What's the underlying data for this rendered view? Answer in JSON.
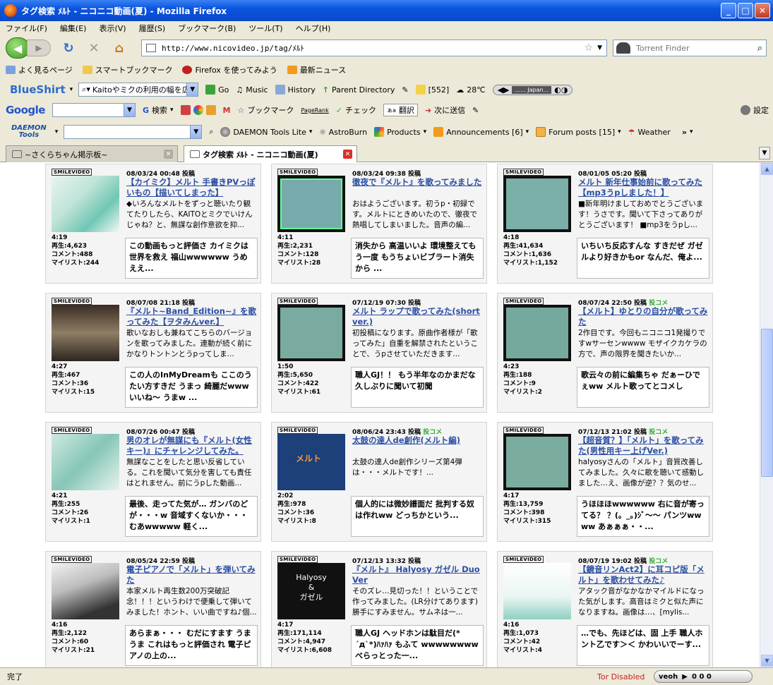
{
  "window": {
    "title": "タグ検索 ﾒﾙﾄ - ニコニコ動画(夏) - Mozilla Firefox"
  },
  "menu": [
    "ファイル(F)",
    "編集(E)",
    "表示(V)",
    "履歴(S)",
    "ブックマーク(B)",
    "ツール(T)",
    "ヘルプ(H)"
  ],
  "nav": {
    "url": "http://www.nicovideo.jp/tag/ﾒﾙﾄ",
    "search_placeholder": "Torrent Finder"
  },
  "bookmarks": [
    "よく見るページ",
    "スマートブックマーク",
    "Firefox を使ってみよう",
    "最新ニュース"
  ],
  "toolbar1": {
    "brand": "BlueShirt",
    "search_value": "Kaitoやミクの利用の幅を広",
    "items": [
      "Go",
      "Music",
      "History",
      "Parent Directory",
      "[552]",
      "28℃"
    ],
    "player_text": "...... Japan..."
  },
  "toolbar2": {
    "brand": "Google",
    "items": [
      "検索",
      "ブックマーク",
      "チェック",
      "翻訳",
      "次に送信",
      "設定"
    ],
    "pagerank": "PageRank"
  },
  "toolbar3": {
    "brand_line1": "DAEMON",
    "brand_line2": "Tools",
    "items": [
      "DAEMON Tools Lite",
      "AstroBurn",
      "Products",
      "Announcements [6]",
      "Forum posts [15]",
      "Weather"
    ]
  },
  "tabs": [
    {
      "label": "~さくらちゃん掲示板~"
    },
    {
      "label": "タグ検索 ﾒﾙﾄ - ニコニコ動画(夏)"
    }
  ],
  "logo_text": "SMILEVIDEO",
  "videos": [
    {
      "date": "08/03/24 00:48 投稿",
      "tag": "",
      "title": "【カイミク】メルト 手書きPVっぽいもの【描いてしまった】",
      "desc": "◆いろんなメルトをずっと聴いたり観てたりしたら、KAITOとミクでいけんじゃね？と、無謀な創作意欲を抑...",
      "duration": "4:19",
      "plays": "再生:4,623",
      "comments": "コメント:488",
      "mylist": "マイリスト:244",
      "comment": "この動画もっと評価さ カイミクは世界を救え 福山wwwwww うめええ..."
    },
    {
      "date": "08/03/24 09:38 投稿",
      "tag": "",
      "title": "徹夜で『メルト』を歌ってみました",
      "desc": "おはようございます。初うp・初録です。メルトにときめいたので、徹夜で熱唱してしまいました。音声の編...",
      "duration": "4:11",
      "plays": "再生:2,231",
      "comments": "コメント:128",
      "mylist": "マイリスト:28",
      "comment": "消失から 高温いいよ 環境整えてもう一度 もうちょいビブラート消失から ..."
    },
    {
      "date": "08/01/05 05:20 投稿",
      "tag": "",
      "title": "メルト 新年仕事始前に歌ってみた【mp3うpしました！】",
      "desc": "■新年明けましておめでとうございます！うさです。聞いて下さってありがとうございます！ ■mp3をうpし...",
      "duration": "4:18",
      "plays": "再生:41,634",
      "comments": "コメント:1,636",
      "mylist": "マイリスト:1,152",
      "comment": "いちいち反応すんな すきだぜ ガゼルより好きかもor なんだ、俺よ..."
    },
    {
      "date": "08/07/08 21:18 投稿",
      "tag": "",
      "title": "『メルト~Band_Edition~』を歌ってみた【ヲタみんver.】",
      "desc": "歌いなおしも兼ねてこちらのバージョンを歌ってみました。連動が続く前にかなりトントンとうpってしま...",
      "duration": "4:27",
      "plays": "再生:467",
      "comments": "コメント:36",
      "mylist": "マイリスト:15",
      "comment": "この人のInMyDreamも ここのうたい方すきだ うまっ 綺麗だwww いいね〜 うまw ..."
    },
    {
      "date": "07/12/19 07:30 投稿",
      "tag": "",
      "title": "メルト ラップで歌ってみた(short ver.)",
      "desc": "初投稿になります。原曲作者様が「歌ってみた」自重を解禁されたということで、うpさせていただきます...",
      "duration": "1:50",
      "plays": "再生:5,650",
      "comments": "コメント:422",
      "mylist": "マイリスト:61",
      "comment": "職人GJ！！ もう半年なのかまだな 久しぶりに聞いて初聞"
    },
    {
      "date": "08/07/24 22:50 投稿",
      "tag": "投コメ",
      "title": "【メルト】ゆとりの自分が歌ってみた",
      "desc": "2作目です。今回もニコニコ1発撮りですwサーセンwwww モザイクカケラの方で、声の限界を聞きたいか...",
      "duration": "4:23",
      "plays": "再生:188",
      "comments": "コメント:9",
      "mylist": "マイリスト:2",
      "comment": "歌云々の前に編集ちゃ だぁーひでぇww メルト歌ってとコメし"
    },
    {
      "date": "08/07/26 00:47 投稿",
      "tag": "",
      "title": "男のオレが無謀にも『メルト(女性キー)』にチャレンジしてみた。",
      "desc": "無謀なことをしたと思い反省している。これを聞いて気分を害しても責任はとれません。前にうpした動画...",
      "duration": "4:21",
      "plays": "再生:255",
      "comments": "コメント:26",
      "mylist": "マイリスト:1",
      "comment": "最後、走ってた気が… ガンバのどが・・・w 音域すくないか・・・ むあwwwww 軽く..."
    },
    {
      "date": "08/06/24 23:43 投稿",
      "tag": "投コメ",
      "title": "太鼓の達人de創作(メルト編)",
      "desc": "太鼓の達人de創作シリーズ第4弾は・・・メルトです！...",
      "duration": "2:02",
      "plays": "再生:978",
      "comments": "コメント:36",
      "mylist": "マイリスト:8",
      "comment": "個人的には微妙譜面だ 批判する奴は作れww どっちかという..."
    },
    {
      "date": "07/12/13 21:02 投稿",
      "tag": "投コメ",
      "title": "【超音質？】「メルト」を歌ってみた(男性用キー上げVer.)",
      "desc": "halyosyさんの「メルト」音質改善してみました。久々に歌を聴いて感動しました…え、画像が逆？？気のせ...",
      "duration": "4:17",
      "plays": "再生:13,759",
      "comments": "コメント:398",
      "mylist": "マイリスト:315",
      "comment": "うほほほwwwwww 右に音が寄ってる？ ？(。_。)ｼﾞ〜〜 パンツww ww あぁぁぁ・・..."
    },
    {
      "date": "08/05/24 22:59 投稿",
      "tag": "",
      "title": "電子ピアノで「メルト」を弾いてみた",
      "desc": "本家メルト再生数200万突破記念！！！というわけで便乗して弾いてみました！ホント、いい曲ですね♪個...",
      "duration": "4:16",
      "plays": "再生:2,122",
      "comments": "コメント:60",
      "mylist": "マイリスト:21",
      "comment": "あらまぁ・・・ むだにすます うまうま これはもっと評価され 電子ピアノの上の..."
    },
    {
      "date": "07/12/13 13:32 投稿",
      "tag": "",
      "title": "『メルト』 Halyosy ガゼル Duo Ver",
      "desc": "そのズレ…見切った！！ということで作ってみました。(LR分けてあります)勝手にすみません。サムネは一...",
      "duration": "4:17",
      "plays": "再生:171,114",
      "comments": "コメント:4,947",
      "mylist": "マイリスト:6,608",
      "comment": "職人GJ ヘッドホンは駄目だ(*´д`*)ﾊｧﾊｧ もふて wwwwwwww べらっとった一..."
    },
    {
      "date": "08/07/19 19:02 投稿",
      "tag": "投コメ",
      "title": "【鏡音リンAct2】に耳コピ版「メルト」を歌わせてみた♪",
      "desc": "アタック音がなかなかマイルドになった気がします。高音はミクと似た声になりますね。画像は…、[mylis...",
      "duration": "4:16",
      "plays": "再生:1,073",
      "comments": "コメント:42",
      "mylist": "マイリスト:4",
      "comment": "…でも、先ほどは、固 上手 職人ホント乙です＞＜ かわいいでーす..."
    }
  ],
  "thumb_text": {
    "taiko": "メルト",
    "duo_line1": "Halyosy",
    "duo_line2": "&",
    "duo_line3": "ガゼル"
  },
  "status": {
    "text": "完了",
    "tor": "Tor Disabled",
    "veoh": "veoh",
    "veoh_counts": "0 0 0"
  }
}
